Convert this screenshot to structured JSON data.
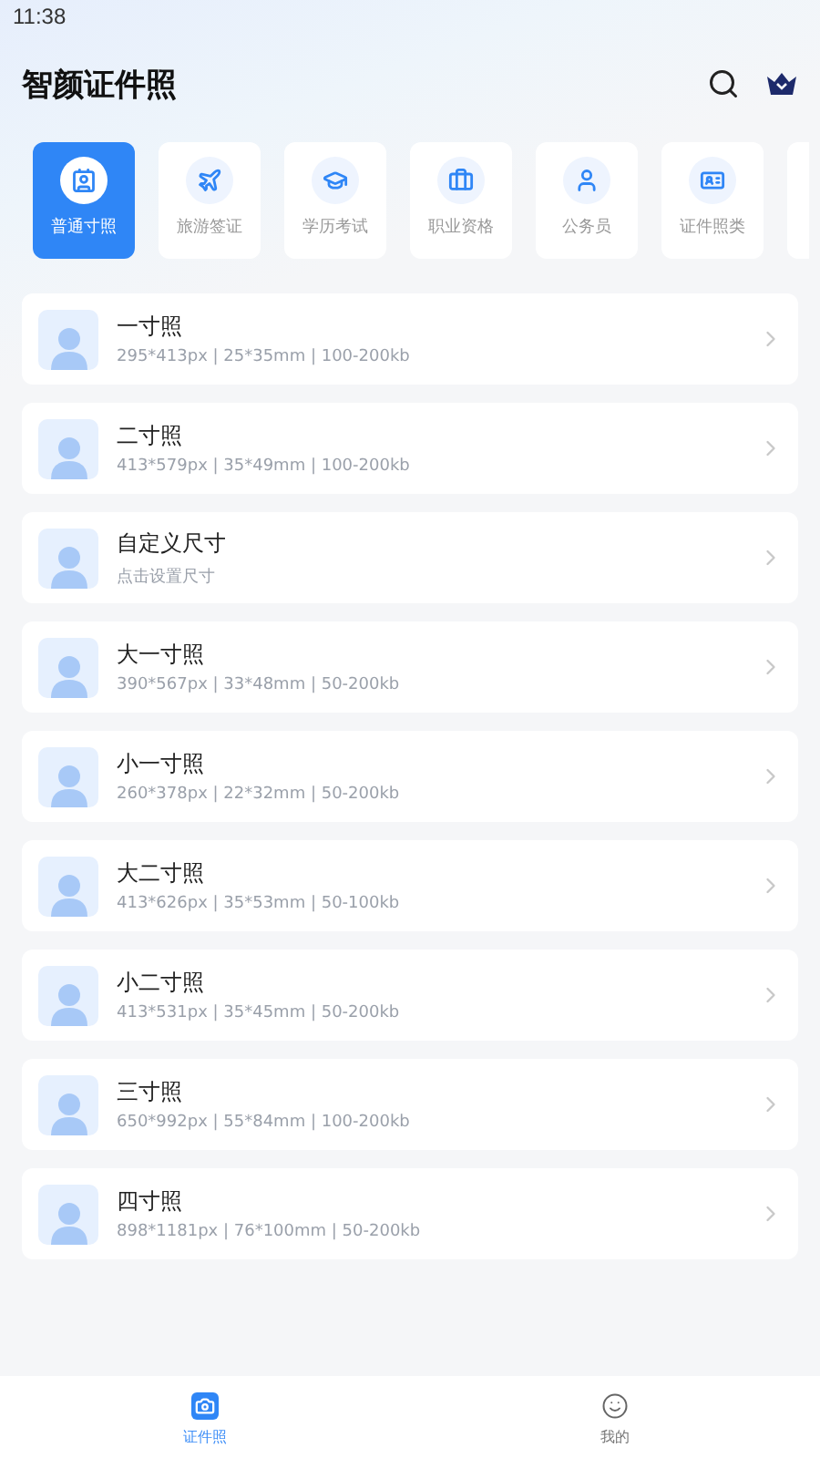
{
  "status_bar": {
    "time": "11:38"
  },
  "header": {
    "title": "智颜证件照"
  },
  "categories": [
    {
      "label": "普通寸照",
      "selected": true
    },
    {
      "label": "旅游签证",
      "selected": false
    },
    {
      "label": "学历考试",
      "selected": false
    },
    {
      "label": "职业资格",
      "selected": false
    },
    {
      "label": "公务员",
      "selected": false
    },
    {
      "label": "证件照类",
      "selected": false
    }
  ],
  "sizes": [
    {
      "name": "一寸照",
      "spec": "295*413px | 25*35mm | 100-200kb"
    },
    {
      "name": "二寸照",
      "spec": "413*579px | 35*49mm | 100-200kb"
    },
    {
      "name": "自定义尺寸",
      "spec": "点击设置尺寸"
    },
    {
      "name": "大一寸照",
      "spec": "390*567px | 33*48mm | 50-200kb"
    },
    {
      "name": "小一寸照",
      "spec": "260*378px | 22*32mm | 50-200kb"
    },
    {
      "name": "大二寸照",
      "spec": "413*626px | 35*53mm | 50-100kb"
    },
    {
      "name": "小二寸照",
      "spec": "413*531px | 35*45mm | 50-200kb"
    },
    {
      "name": "三寸照",
      "spec": "650*992px | 55*84mm | 100-200kb"
    },
    {
      "name": "四寸照",
      "spec": "898*1181px | 76*100mm | 50-200kb"
    }
  ],
  "tab_bar": [
    {
      "label": "证件照",
      "selected": true
    },
    {
      "label": "我的",
      "selected": false
    }
  ]
}
